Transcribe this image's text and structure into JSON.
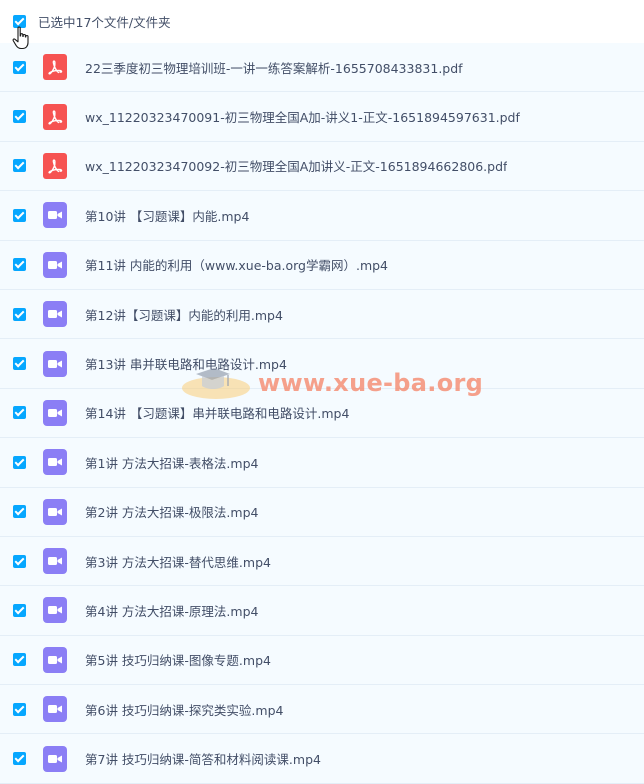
{
  "header": {
    "selection_label": "已选中17个文件/文件夹"
  },
  "colors": {
    "checkbox": "#06a7ff",
    "pdf_icon": "#f65352",
    "video_icon": "#8b7ef5",
    "row_bg": "#f5fbff"
  },
  "files": [
    {
      "name": "22三季度初三物理培训班-一讲一练答案解析-1655708433831.pdf",
      "icon": "pdf-icon"
    },
    {
      "name": "wx_11220323470091-初三物理全国A加-讲义1-正文-1651894597631.pdf",
      "icon": "pdf-icon"
    },
    {
      "name": "wx_11220323470092-初三物理全国A加讲义-正文-1651894662806.pdf",
      "icon": "pdf-icon"
    },
    {
      "name": "第10讲 【习题课】内能.mp4",
      "icon": "video-icon"
    },
    {
      "name": "第11讲 内能的利用（www.xue-ba.org学霸网）.mp4",
      "icon": "video-icon"
    },
    {
      "name": "第12讲【习题课】内能的利用.mp4",
      "icon": "video-icon"
    },
    {
      "name": "第13讲 串并联电路和电路设计.mp4",
      "icon": "video-icon"
    },
    {
      "name": "第14讲 【习题课】串并联电路和电路设计.mp4",
      "icon": "video-icon"
    },
    {
      "name": "第1讲 方法大招课-表格法.mp4",
      "icon": "video-icon"
    },
    {
      "name": "第2讲 方法大招课-极限法.mp4",
      "icon": "video-icon"
    },
    {
      "name": "第3讲 方法大招课-替代思维.mp4",
      "icon": "video-icon"
    },
    {
      "name": "第4讲 方法大招课-原理法.mp4",
      "icon": "video-icon"
    },
    {
      "name": "第5讲 技巧归纳课-图像专题.mp4",
      "icon": "video-icon"
    },
    {
      "name": "第6讲 技巧归纳课-探究类实验.mp4",
      "icon": "video-icon"
    },
    {
      "name": "第7讲 技巧归纳课-简答和材料阅读课.mp4",
      "icon": "video-icon"
    }
  ],
  "watermark": {
    "text": "www.xue-ba.org"
  }
}
